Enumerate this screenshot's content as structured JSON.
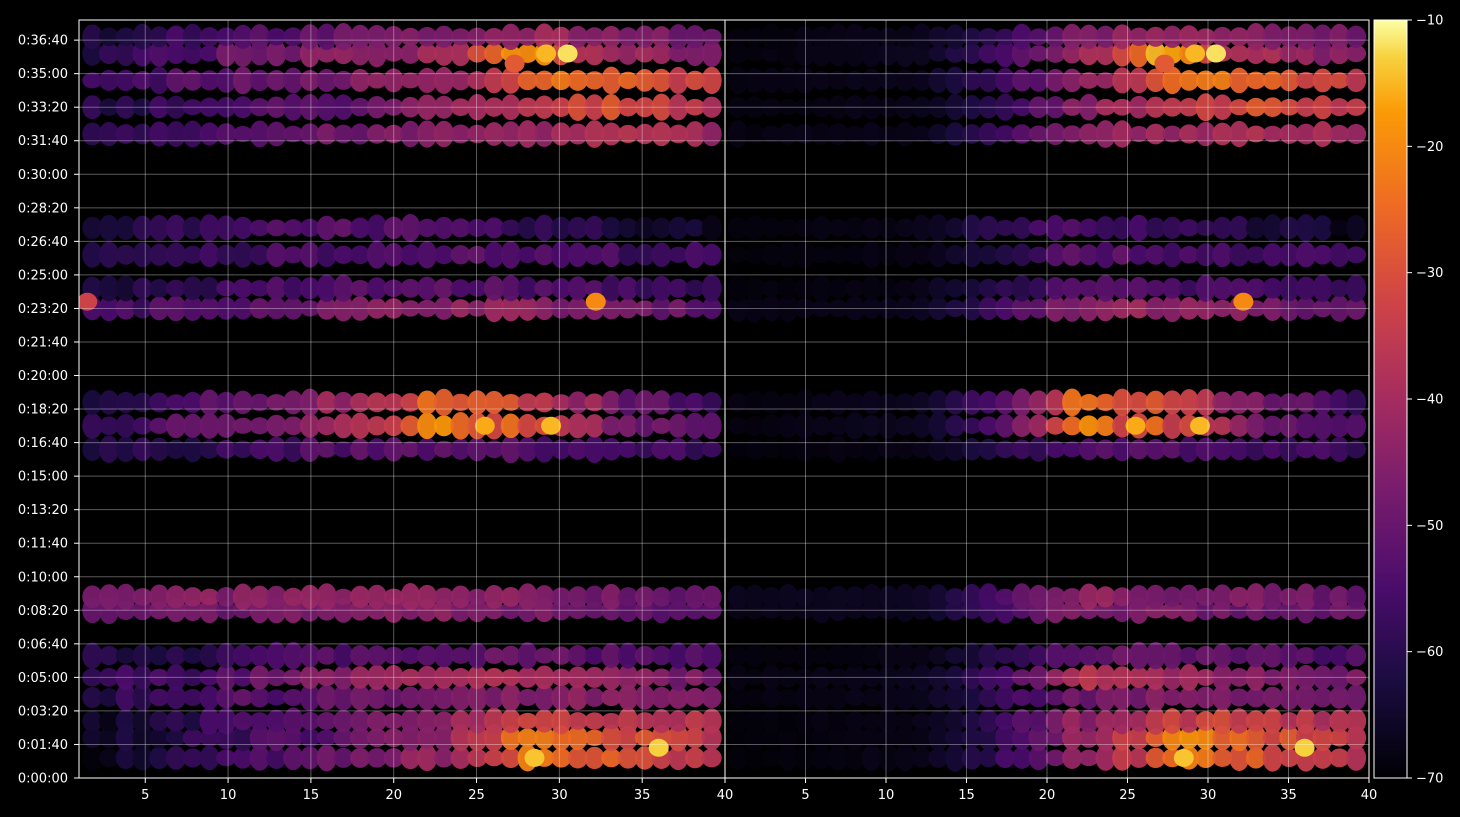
{
  "chart_data": {
    "type": "heatmap",
    "title": "",
    "xlabel": "",
    "ylabel": "",
    "grid": true,
    "panels": [
      {
        "name": "",
        "xlim": [
          1,
          40
        ],
        "xticks": [
          "5",
          "10",
          "15",
          "20",
          "25",
          "30",
          "35"
        ]
      },
      {
        "name": "",
        "xlim": [
          0,
          40
        ],
        "xticks": [
          "40",
          "5",
          "10",
          "15",
          "20",
          "25",
          "30",
          "35",
          "40"
        ]
      }
    ],
    "ylim_seconds": [
      0,
      2260
    ],
    "yticks": [
      "0:00:00",
      "0:01:40",
      "0:03:20",
      "0:05:00",
      "0:06:40",
      "0:08:20",
      "0:10:00",
      "0:11:40",
      "0:13:20",
      "0:15:00",
      "0:16:40",
      "0:18:20",
      "0:20:00",
      "0:21:40",
      "0:23:20",
      "0:25:00",
      "0:26:40",
      "0:28:20",
      "0:30:00",
      "0:31:40",
      "0:33:20",
      "0:35:00",
      "0:36:40"
    ],
    "colorbar": {
      "min": -70,
      "max": -10,
      "ticks": [
        "−10",
        "−20",
        "−30",
        "−40",
        "−50",
        "−60",
        "−70"
      ],
      "colormap": "inferno"
    },
    "bands": [
      {
        "y": 60,
        "levels": [
          -66,
          -64,
          -63,
          -60,
          -58,
          -56,
          -55,
          -54,
          -52,
          -50,
          -48,
          -46,
          -44,
          -42,
          -40,
          -36,
          -30,
          -22,
          -24,
          -28,
          -26,
          -32,
          -34,
          -36,
          -38
        ]
      },
      {
        "y": 120,
        "levels": [
          -65,
          -63,
          -62,
          -60,
          -58,
          -57,
          -55,
          -54,
          -53,
          -51,
          -49,
          -47,
          -45,
          -42,
          -38,
          -32,
          -24,
          -20,
          -22,
          -26,
          -28,
          -30,
          -32,
          -34,
          -36
        ]
      },
      {
        "y": 170,
        "levels": [
          -66,
          -64,
          -62,
          -60,
          -58,
          -56,
          -55,
          -54,
          -52,
          -50,
          -48,
          -47,
          -45,
          -43,
          -40,
          -38,
          -36,
          -34,
          -33,
          -32,
          -34,
          -35,
          -36,
          -37,
          -38
        ]
      },
      {
        "y": 240,
        "levels": [
          -60,
          -58,
          -56,
          -55,
          -54,
          -53,
          -52,
          -52,
          -51,
          -50,
          -50,
          -49,
          -48,
          -48,
          -47,
          -47,
          -46,
          -46,
          -46,
          -45,
          -45,
          -46,
          -46,
          -47,
          -47
        ]
      },
      {
        "y": 300,
        "levels": [
          -58,
          -57,
          -56,
          -55,
          -54,
          -52,
          -50,
          -48,
          -46,
          -45,
          -44,
          -42,
          -40,
          -38,
          -38,
          -39,
          -40,
          -41,
          -42,
          -43,
          -44,
          -45,
          -46,
          -47,
          -47
        ]
      },
      {
        "y": 365,
        "levels": [
          -62,
          -61,
          -60,
          -59,
          -58,
          -57,
          -56,
          -55,
          -54,
          -53,
          -52,
          -52,
          -51,
          -51,
          -50,
          -50,
          -50,
          -51,
          -51,
          -52,
          -52,
          -53,
          -53,
          -54,
          -54
        ]
      },
      {
        "y": 500,
        "levels": [
          -52,
          -51,
          -50,
          -49,
          -48,
          -48,
          -47,
          -47,
          -46,
          -46,
          -45,
          -45,
          -45,
          -45,
          -46,
          -46,
          -47,
          -47,
          -48,
          -48,
          -49,
          -49,
          -50,
          -50,
          -51
        ]
      },
      {
        "y": 540,
        "levels": [
          -48,
          -47,
          -46,
          -46,
          -45,
          -45,
          -44,
          -44,
          -44,
          -43,
          -43,
          -43,
          -43,
          -44,
          -44,
          -45,
          -45,
          -46,
          -46,
          -47,
          -47,
          -48,
          -48,
          -49,
          -49
        ]
      },
      {
        "y": 980,
        "levels": [
          -62,
          -61,
          -60,
          -59,
          -58,
          -57,
          -56,
          -55,
          -54,
          -54,
          -53,
          -53,
          -52,
          -52,
          -52,
          -53,
          -53,
          -54,
          -54,
          -55,
          -55,
          -56,
          -56,
          -57,
          -57
        ]
      },
      {
        "y": 1050,
        "levels": [
          -58,
          -56,
          -54,
          -52,
          -50,
          -48,
          -46,
          -44,
          -42,
          -40,
          -38,
          -34,
          -28,
          -20,
          -24,
          -30,
          -26,
          -32,
          -36,
          -40,
          -44,
          -48,
          -50,
          -52,
          -54
        ]
      },
      {
        "y": 1120,
        "levels": [
          -60,
          -58,
          -56,
          -54,
          -52,
          -50,
          -48,
          -46,
          -44,
          -42,
          -40,
          -36,
          -30,
          -24,
          -26,
          -28,
          -30,
          -34,
          -38,
          -42,
          -46,
          -50,
          -52,
          -54,
          -56
        ]
      },
      {
        "y": 1400,
        "levels": [
          -56,
          -55,
          -54,
          -53,
          -52,
          -51,
          -50,
          -49,
          -48,
          -47,
          -46,
          -45,
          -44,
          -43,
          -42,
          -42,
          -43,
          -44,
          -45,
          -46,
          -47,
          -48,
          -49,
          -50,
          -51
        ]
      },
      {
        "y": 1460,
        "levels": [
          -62,
          -61,
          -60,
          -59,
          -58,
          -57,
          -56,
          -55,
          -54,
          -54,
          -53,
          -53,
          -52,
          -52,
          -52,
          -53,
          -53,
          -54,
          -54,
          -55,
          -55,
          -56,
          -56,
          -57,
          -57
        ]
      },
      {
        "y": 1560,
        "levels": [
          -62,
          -61,
          -60,
          -59,
          -58,
          -57,
          -56,
          -55,
          -54,
          -54,
          -53,
          -53,
          -52,
          -52,
          -52,
          -53,
          -53,
          -54,
          -54,
          -55,
          -55,
          -56,
          -56,
          -57,
          -57
        ]
      },
      {
        "y": 1640,
        "levels": [
          -64,
          -62,
          -60,
          -58,
          -56,
          -55,
          -54,
          -53,
          -52,
          -52,
          -52,
          -53,
          -54,
          -55,
          -56,
          -57,
          -58,
          -59,
          -60,
          -61,
          -62,
          -63,
          -64,
          -65,
          -66
        ]
      },
      {
        "y": 1920,
        "levels": [
          -58,
          -57,
          -56,
          -55,
          -54,
          -53,
          -52,
          -51,
          -50,
          -49,
          -48,
          -47,
          -46,
          -45,
          -44,
          -43,
          -42,
          -41,
          -40,
          -39,
          -38,
          -38,
          -39,
          -40,
          -41
        ]
      },
      {
        "y": 2000,
        "levels": [
          -60,
          -59,
          -58,
          -57,
          -56,
          -55,
          -54,
          -53,
          -52,
          -51,
          -50,
          -48,
          -46,
          -44,
          -42,
          -40,
          -38,
          -36,
          -34,
          -32,
          -30,
          -30,
          -32,
          -34,
          -36
        ]
      },
      {
        "y": 2080,
        "levels": [
          -56,
          -55,
          -54,
          -53,
          -52,
          -51,
          -50,
          -49,
          -48,
          -47,
          -46,
          -45,
          -44,
          -42,
          -40,
          -36,
          -30,
          -26,
          -24,
          -24,
          -26,
          -28,
          -30,
          -32,
          -34
        ]
      },
      {
        "y": 2160,
        "levels": [
          -60,
          -58,
          -56,
          -54,
          -52,
          -50,
          -48,
          -47,
          -46,
          -45,
          -44,
          -43,
          -42,
          -40,
          -36,
          -28,
          -16,
          -18,
          -32,
          -36,
          -38,
          -40,
          -42,
          -44,
          -46
        ]
      },
      {
        "y": 2210,
        "levels": [
          -62,
          -60,
          -58,
          -56,
          -55,
          -54,
          -53,
          -52,
          -51,
          -50,
          -49,
          -48,
          -47,
          -46,
          -45,
          -44,
          -43,
          -42,
          -42,
          -43,
          -44,
          -45,
          -46,
          -47,
          -48
        ]
      }
    ],
    "highlights": [
      {
        "y": 2160,
        "x": 30.5,
        "level": -12
      },
      {
        "y": 2160,
        "x": 29.2,
        "level": -15
      },
      {
        "y": 2130,
        "x": 27.3,
        "level": -28
      },
      {
        "y": 1420,
        "x": 32.2,
        "level": -20
      },
      {
        "y": 1050,
        "x": 25.5,
        "level": -16
      },
      {
        "y": 1050,
        "x": 29.5,
        "level": -15
      },
      {
        "y": 90,
        "x": 36.0,
        "level": -13
      },
      {
        "y": 60,
        "x": 28.5,
        "level": -14
      },
      {
        "y": 1420,
        "x": 1.5,
        "level": -33
      }
    ]
  }
}
